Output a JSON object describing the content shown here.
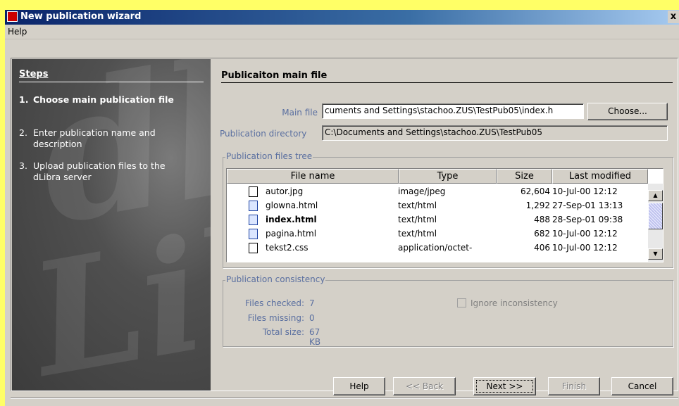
{
  "window": {
    "title": "New publication wizard",
    "close_glyph": "x"
  },
  "menu": {
    "help": "Help"
  },
  "steps": {
    "title": "Steps",
    "items": [
      {
        "num": "1.",
        "label": "Choose main publication file"
      },
      {
        "num": "2.",
        "label": "Enter publication name and description"
      },
      {
        "num": "3.",
        "label": "Upload publication files to the dLibra server"
      }
    ]
  },
  "main": {
    "heading": "Publicaiton main file",
    "main_file_label": "Main file",
    "main_file_value": "cuments and Settings\\stachoo.ZUS\\TestPub05\\index.h",
    "choose_button": "Choose...",
    "pub_dir_label": "Publication directory",
    "pub_dir_value": "C:\\Documents and Settings\\stachoo.ZUS\\TestPub05",
    "files_tree_label": "Publication files tree",
    "columns": [
      "File name",
      "Type",
      "Size",
      "Last modified"
    ],
    "rows": [
      {
        "name": "autor.jpg",
        "type": "image/jpeg",
        "size": "62,604",
        "modified": "10-Jul-00 12:12",
        "icon": "document-icon"
      },
      {
        "name": "glowna.html",
        "type": "text/html",
        "size": "1,292",
        "modified": "27-Sep-01 13:13",
        "icon": "html-file-icon"
      },
      {
        "name": "index.html",
        "type": "text/html",
        "size": "488",
        "modified": "28-Sep-01 09:38",
        "icon": "html-file-icon"
      },
      {
        "name": "pagina.html",
        "type": "text/html",
        "size": "682",
        "modified": "10-Jul-00 12:12",
        "icon": "html-file-icon"
      },
      {
        "name": "tekst2.css",
        "type": "application/octet-",
        "size": "406",
        "modified": "10-Jul-00 12:12",
        "icon": "document-icon"
      }
    ],
    "consistency_label": "Publication consistency",
    "files_checked_label": "Files checked:",
    "files_checked_value": "7",
    "files_missing_label": "Files missing:",
    "files_missing_value": "0",
    "total_size_label": "Total size:",
    "total_size_value": "67 KB",
    "ignore_label": "Ignore inconsistency"
  },
  "buttons": {
    "help": "Help",
    "back": "<< Back",
    "next": "Next >>",
    "finish": "Finish",
    "cancel": "Cancel"
  }
}
